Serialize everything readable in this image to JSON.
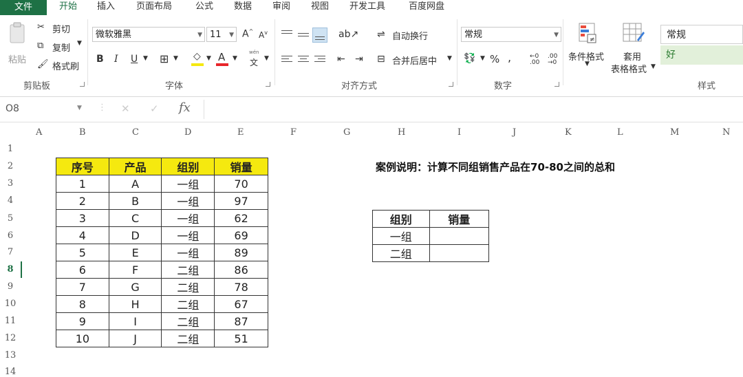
{
  "menu": {
    "file": "文件",
    "tabs": [
      "开始",
      "插入",
      "页面布局",
      "公式",
      "数据",
      "审阅",
      "视图",
      "开发工具",
      "百度网盘"
    ],
    "active_tab": "开始"
  },
  "ribbon": {
    "clipboard": {
      "paste": "粘贴",
      "cut": "剪切",
      "copy": "复制",
      "format_painter": "格式刷",
      "label": "剪贴板"
    },
    "font": {
      "name": "微软雅黑",
      "size": "11",
      "bold": "B",
      "italic": "I",
      "underline": "U",
      "font_color_letter": "A",
      "wen": "wén",
      "wen_char": "文",
      "grow": "A",
      "shrink": "A",
      "label": "字体"
    },
    "alignment": {
      "wrap": "自动换行",
      "merge": "合并后居中",
      "label": "对齐方式"
    },
    "number": {
      "format": "常规",
      "percent": "%",
      "comma": ",",
      "label": "数字"
    },
    "styles": {
      "conditional": "条件格式",
      "table1": "套用",
      "table2": "表格格式",
      "normal": "常规",
      "good": "好",
      "label": "样式"
    }
  },
  "formula_bar": {
    "name_box": "O8",
    "fx": "fx",
    "cancel": "✕",
    "enter": "✓"
  },
  "columns": [
    "A",
    "B",
    "C",
    "D",
    "E",
    "F",
    "G",
    "H",
    "I",
    "J",
    "K",
    "L",
    "M",
    "N"
  ],
  "rows": [
    "1",
    "2",
    "3",
    "4",
    "5",
    "6",
    "7",
    "8",
    "9",
    "10",
    "11",
    "12",
    "13",
    "14"
  ],
  "active_row": "8",
  "table": {
    "headers": [
      "序号",
      "产品",
      "组别",
      "销量"
    ],
    "rows": [
      [
        "1",
        "A",
        "一组",
        "70"
      ],
      [
        "2",
        "B",
        "一组",
        "97"
      ],
      [
        "3",
        "C",
        "一组",
        "62"
      ],
      [
        "4",
        "D",
        "一组",
        "69"
      ],
      [
        "5",
        "E",
        "一组",
        "89"
      ],
      [
        "6",
        "F",
        "二组",
        "86"
      ],
      [
        "7",
        "G",
        "二组",
        "78"
      ],
      [
        "8",
        "H",
        "二组",
        "67"
      ],
      [
        "9",
        "I",
        "二组",
        "87"
      ],
      [
        "10",
        "J",
        "二组",
        "51"
      ]
    ]
  },
  "description": "案例说明：计算不同组销售产品在70-80之间的总和",
  "summary": {
    "headers": [
      "组别",
      "销量"
    ],
    "rows": [
      [
        "一组",
        ""
      ],
      [
        "二组",
        ""
      ]
    ]
  },
  "colors": {
    "accent": "#1e7145",
    "header_fill": "#f5e90f",
    "good_fill": "#e2f0da"
  }
}
